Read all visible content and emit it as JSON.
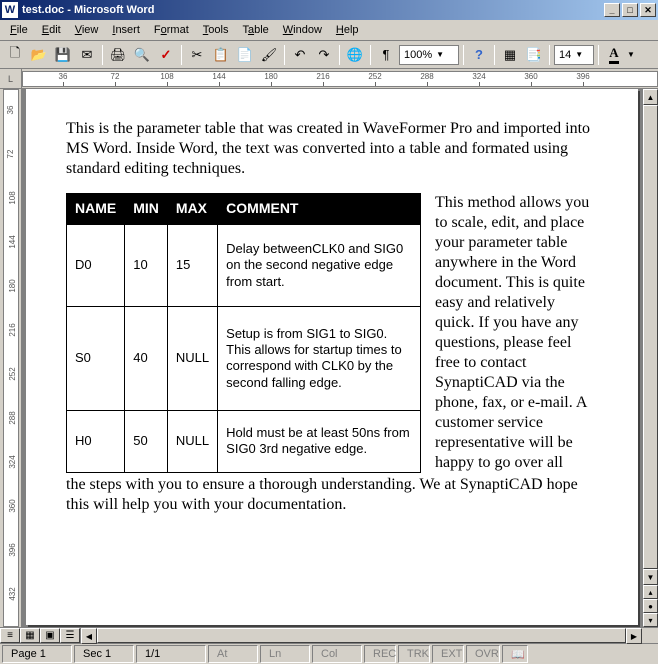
{
  "title": "test.doc - Microsoft Word",
  "menu": [
    "File",
    "Edit",
    "View",
    "Insert",
    "Format",
    "Tools",
    "Table",
    "Window",
    "Help"
  ],
  "toolbar": {
    "zoom": "100%",
    "fontsize": "14"
  },
  "ruler_h": [
    "36",
    "72",
    "108",
    "144",
    "180",
    "216",
    "252",
    "288",
    "324",
    "360",
    "396"
  ],
  "ruler_v": [
    "36",
    "72",
    "108",
    "144",
    "180",
    "216",
    "252",
    "288",
    "324",
    "360",
    "396",
    "432"
  ],
  "document": {
    "intro": "This is the parameter table that was created in WaveFormer Pro and imported into MS Word. Inside Word, the text was converted into a table and formated using standard editing techniques.",
    "table": {
      "headers": [
        "NAME",
        "MIN",
        "MAX",
        "COMMENT"
      ],
      "rows": [
        {
          "name": "D0",
          "min": "10",
          "max": "15",
          "comment": "Delay betweenCLK0 and SIG0 on the second negative edge from start."
        },
        {
          "name": "S0",
          "min": "40",
          "max": "NULL",
          "comment": "Setup is from SIG1 to SIG0. This allows for startup times to correspond with CLK0 by the second falling edge."
        },
        {
          "name": "H0",
          "min": "50",
          "max": "NULL",
          "comment": "Hold must be at least 50ns from SIG0 3rd negative edge."
        }
      ]
    },
    "side_text": "This method allows you to scale, edit, and place your parameter table anywhere in the Word document. This is quite easy and relatively quick. If you have any questions, please feel free to contact SynaptiCAD via the phone, fax, or e-mail. A customer service representative will be happy to go over all",
    "tail_text": "the steps with you to ensure a thorough understanding. We at SynaptiCAD hope this will help you with your documentation."
  },
  "status": {
    "page": "Page  1",
    "sec": "Sec 1",
    "pages": "1/1",
    "at": "At",
    "ln": "Ln",
    "col": "Col",
    "indicators": [
      "REC",
      "TRK",
      "EXT",
      "OVR"
    ]
  }
}
